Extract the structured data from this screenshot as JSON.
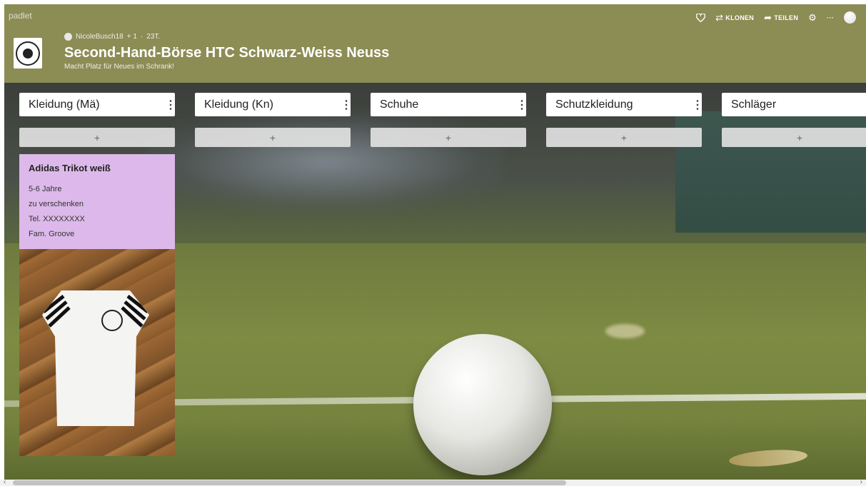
{
  "app": {
    "brand": "padlet"
  },
  "header": {
    "author": "NicoleBusch18",
    "likes": "+ 1",
    "sep": "·",
    "age": "23T.",
    "title": "Second-Hand-Börse HTC Schwarz-Weiss Neuss",
    "subtitle": "Macht Platz für Neues im Schrank!"
  },
  "toolbar": {
    "clone_label": "KLONEN",
    "share_label": "TEILEN",
    "more_label": "···"
  },
  "columns": [
    {
      "title": "Kleidung (Mä)",
      "menu": "⋮",
      "add": "+"
    },
    {
      "title": "Kleidung (Kn)",
      "menu": "⋮",
      "add": "+"
    },
    {
      "title": "Schuhe",
      "menu": "⋮",
      "add": "+"
    },
    {
      "title": "Schutzkleidung",
      "menu": "⋮",
      "add": "+"
    },
    {
      "title": "Schläger",
      "menu": "",
      "add": "+"
    }
  ],
  "post": {
    "title": "Adidas Trikot weiß",
    "lines": [
      "5-6 Jahre",
      "zu verschenken",
      "Tel. XXXXXXXX",
      "Fam. Groove"
    ],
    "color": "#dcb9ea"
  },
  "colors": {
    "header_bg": "#8c8c55"
  }
}
